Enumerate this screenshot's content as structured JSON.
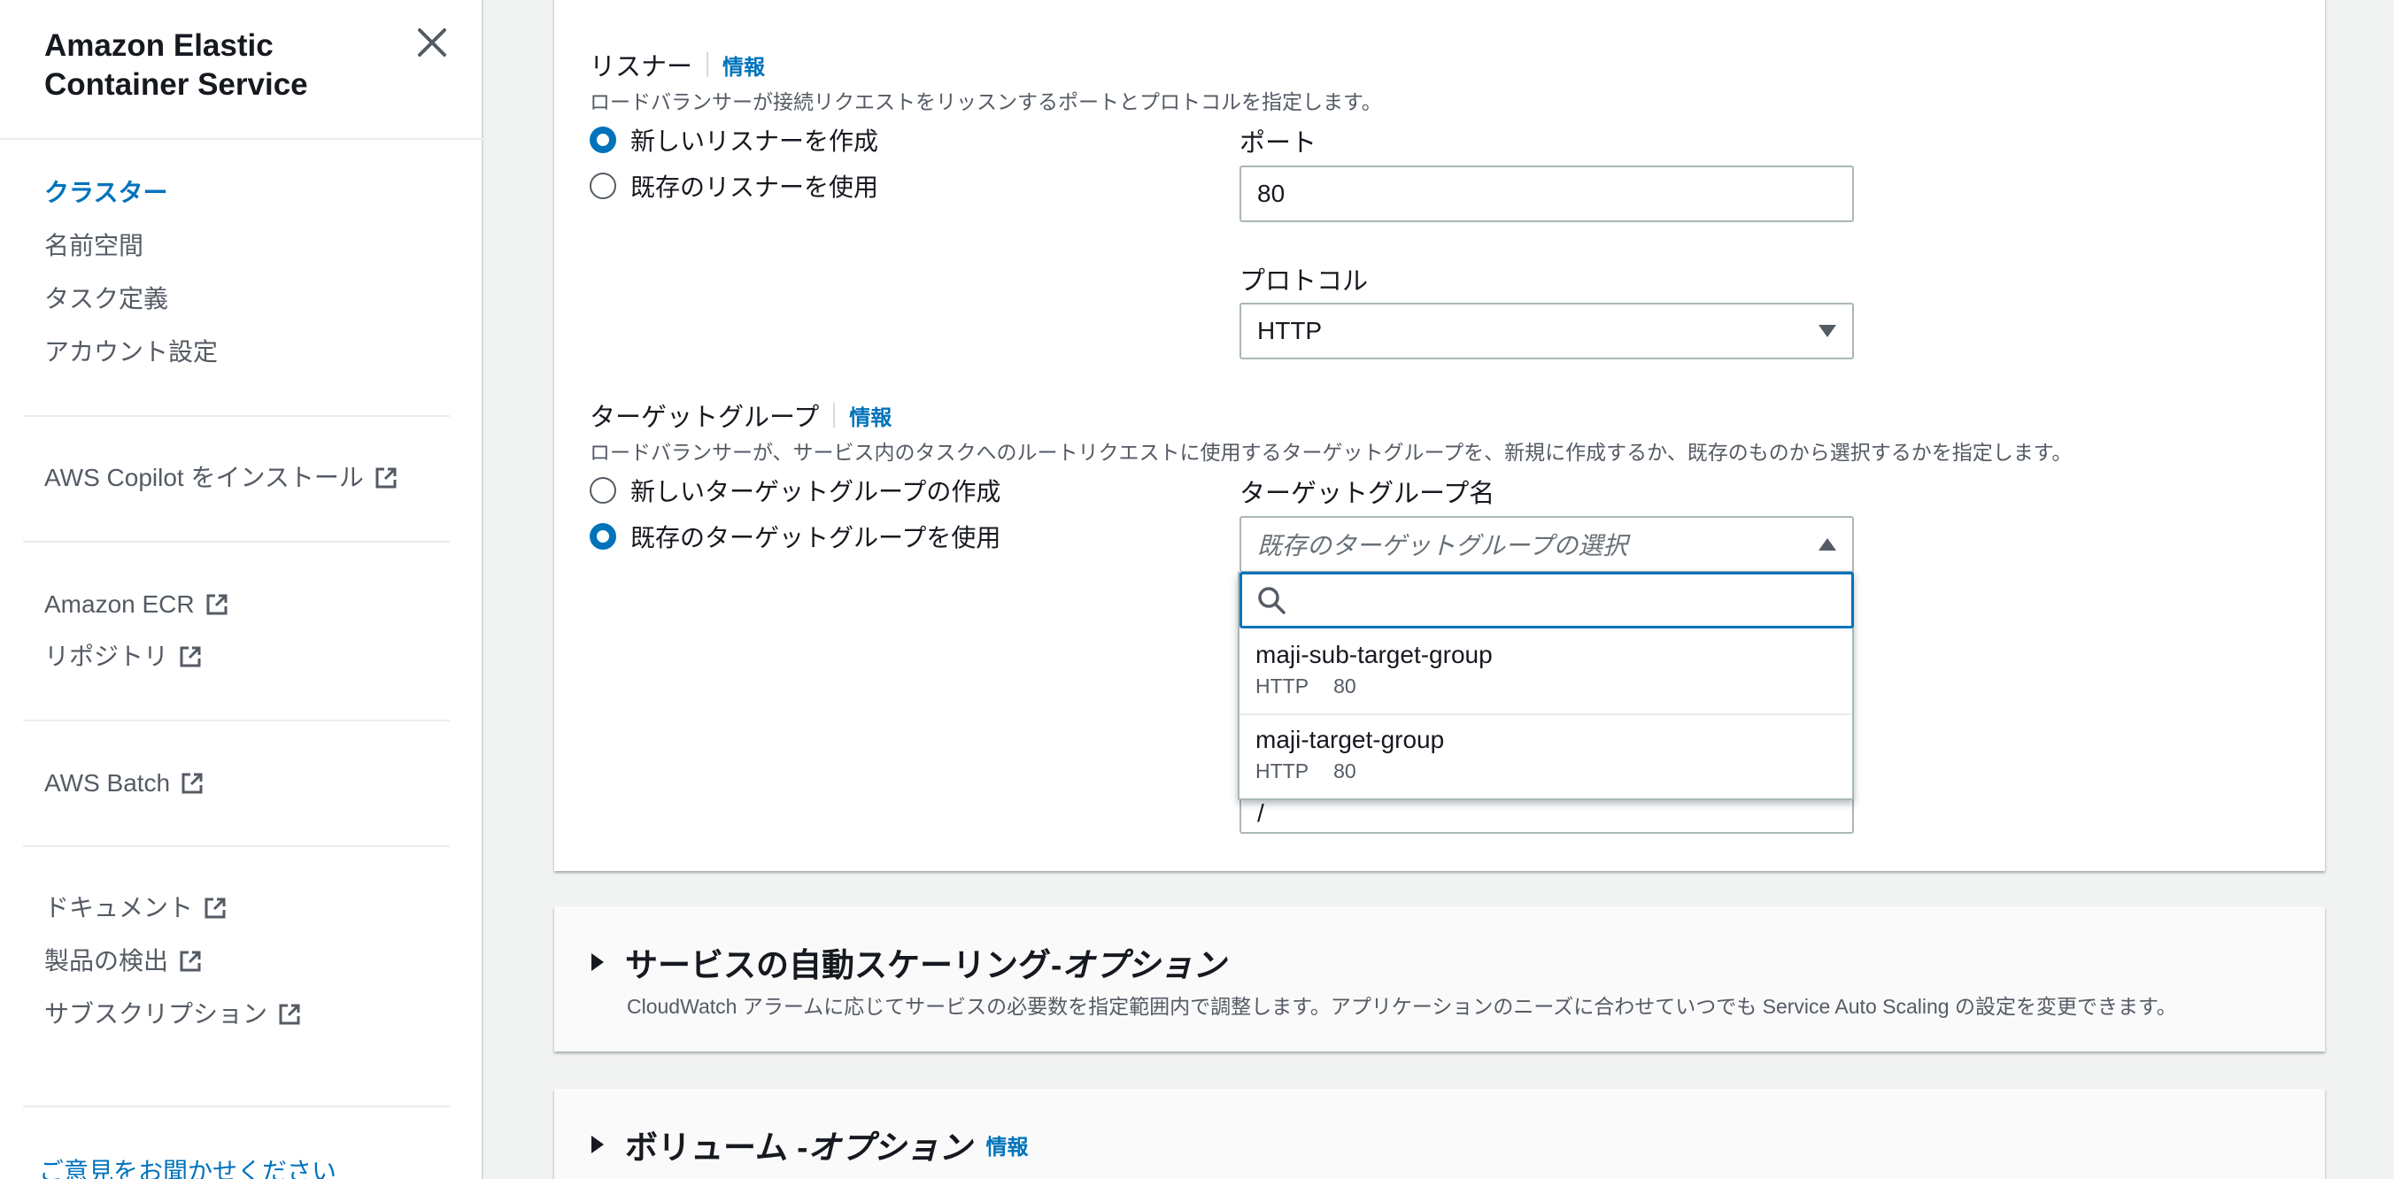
{
  "sidebar": {
    "title_line1": "Amazon Elastic",
    "title_line2": "Container Service",
    "nav": [
      "クラスター",
      "名前空間",
      "タスク定義",
      "アカウント設定"
    ],
    "copilot": "AWS Copilot をインストール",
    "ecr": "Amazon ECR",
    "repository": "リポジトリ",
    "batch": "AWS Batch",
    "docs": "ドキュメント",
    "discovery": "製品の検出",
    "subscription": "サブスクリプション",
    "feedback": "ご意見をお聞かせください"
  },
  "listener": {
    "label": "リスナー",
    "info": "情報",
    "description": "ロードバランサーが接続リクエストをリッスンするポートとプロトコルを指定します。",
    "options": [
      "新しいリスナーを作成",
      "既存のリスナーを使用"
    ],
    "selected": 0,
    "port_label": "ポート",
    "port_value": "80",
    "protocol_label": "プロトコル",
    "protocol_value": "HTTP"
  },
  "target_group": {
    "label": "ターゲットグループ",
    "info": "情報",
    "description": "ロードバランサーが、サービス内のタスクへのルートリクエストに使用するターゲットグループを、新規に作成するか、既存のものから選択するかを指定します。",
    "options": [
      "新しいターゲットグループの作成",
      "既存のターゲットグループを使用"
    ],
    "selected": 1,
    "name_label": "ターゲットグループ名",
    "name_placeholder": "既存のターゲットグループの選択",
    "hidden_value": "/",
    "dropdown": {
      "search_value": "",
      "items": [
        {
          "name": "maji-sub-target-group",
          "protocol": "HTTP",
          "port": "80"
        },
        {
          "name": "maji-target-group",
          "protocol": "HTTP",
          "port": "80"
        }
      ]
    }
  },
  "autoscaling": {
    "title": "サービスの自動スケーリング- ",
    "title_suffix": "オプション",
    "description": "CloudWatch アラームに応じてサービスの必要数を指定範囲内で調整します。アプリケーションのニーズに合わせていつでも Service Auto Scaling の設定を変更できます。"
  },
  "volume": {
    "title": "ボリューム - ",
    "title_suffix": "オプション",
    "info": "情報"
  },
  "colors": {
    "accent": "#0073bb",
    "text": "#16191f",
    "muted": "#545b64"
  }
}
